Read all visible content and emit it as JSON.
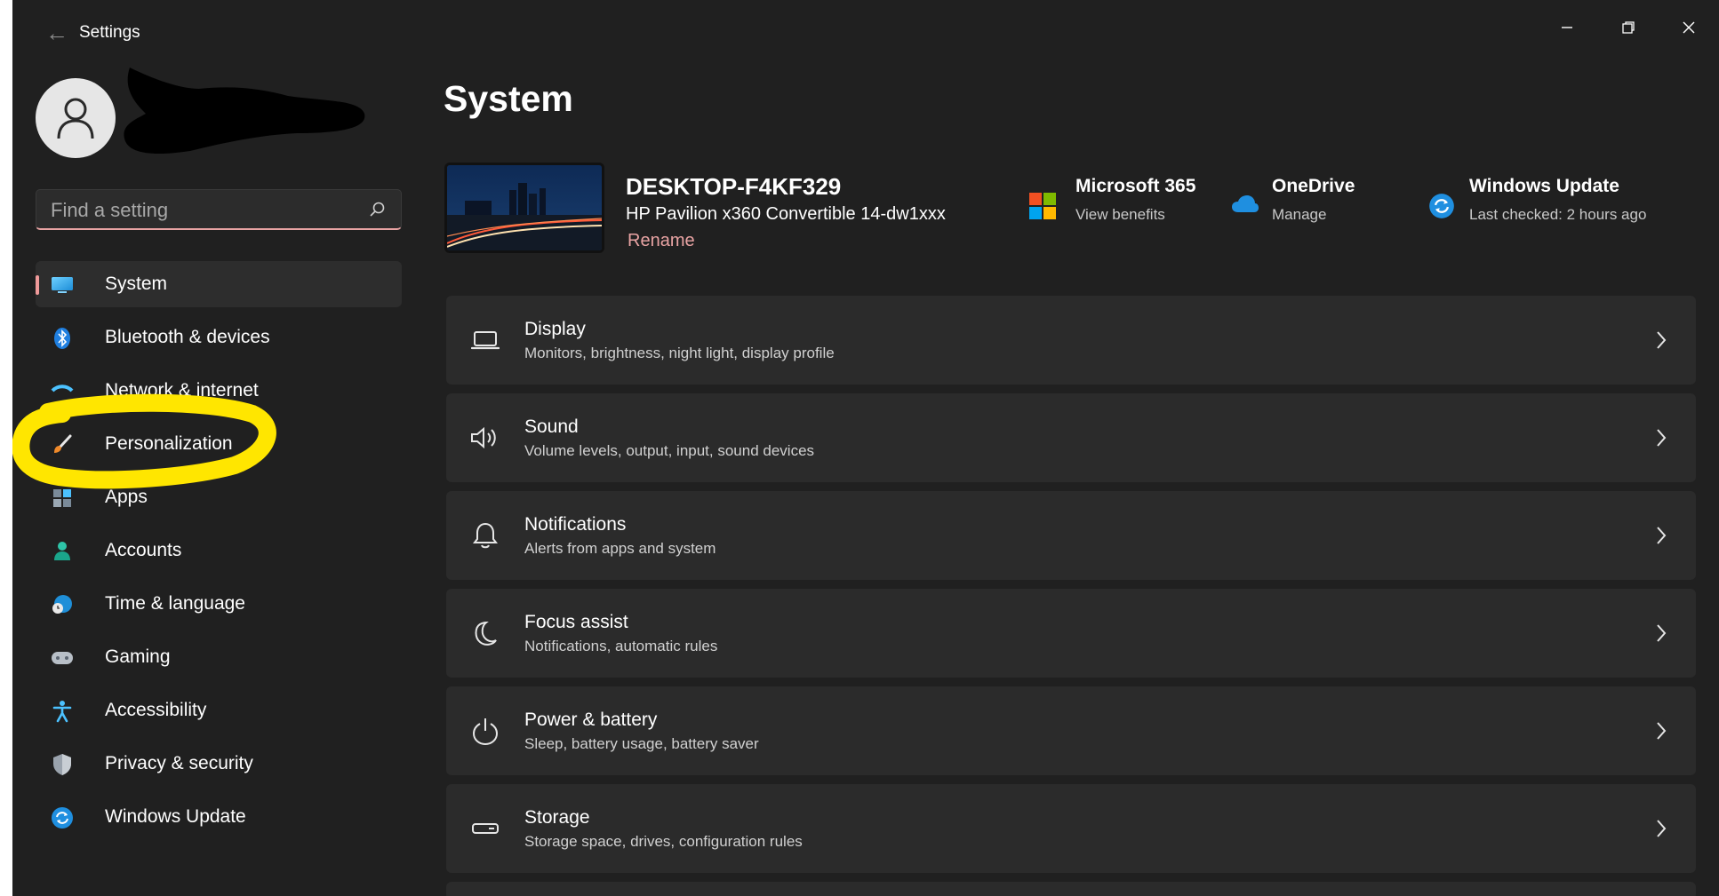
{
  "window": {
    "title": "Settings"
  },
  "search": {
    "placeholder": "Find a setting"
  },
  "sidebar": {
    "items": [
      {
        "label": "System",
        "icon": "monitor-icon"
      },
      {
        "label": "Bluetooth & devices",
        "icon": "bluetooth-icon"
      },
      {
        "label": "Network & internet",
        "icon": "wifi-icon"
      },
      {
        "label": "Personalization",
        "icon": "brush-icon"
      },
      {
        "label": "Apps",
        "icon": "apps-icon"
      },
      {
        "label": "Accounts",
        "icon": "person-icon"
      },
      {
        "label": "Time & language",
        "icon": "globe-clock-icon"
      },
      {
        "label": "Gaming",
        "icon": "gamepad-icon"
      },
      {
        "label": "Accessibility",
        "icon": "accessibility-icon"
      },
      {
        "label": "Privacy & security",
        "icon": "shield-icon"
      },
      {
        "label": "Windows Update",
        "icon": "sync-icon"
      }
    ],
    "active_index": 0
  },
  "main": {
    "title": "System",
    "device": {
      "name": "DESKTOP-F4KF329",
      "model": "HP Pavilion x360 Convertible 14-dw1xxx",
      "rename_label": "Rename"
    },
    "quick_links": [
      {
        "title": "Microsoft 365",
        "subtitle": "View benefits",
        "icon": "microsoft-logo-icon"
      },
      {
        "title": "OneDrive",
        "subtitle": "Manage",
        "icon": "cloud-icon"
      },
      {
        "title": "Windows Update",
        "subtitle": "Last checked: 2 hours ago",
        "icon": "sync-icon"
      }
    ],
    "cards": [
      {
        "title": "Display",
        "subtitle": "Monitors, brightness, night light, display profile",
        "icon": "laptop-icon"
      },
      {
        "title": "Sound",
        "subtitle": "Volume levels, output, input, sound devices",
        "icon": "speaker-icon"
      },
      {
        "title": "Notifications",
        "subtitle": "Alerts from apps and system",
        "icon": "bell-icon"
      },
      {
        "title": "Focus assist",
        "subtitle": "Notifications, automatic rules",
        "icon": "moon-icon"
      },
      {
        "title": "Power & battery",
        "subtitle": "Sleep, battery usage, battery saver",
        "icon": "power-icon"
      },
      {
        "title": "Storage",
        "subtitle": "Storage space, drives, configuration rules",
        "icon": "storage-icon"
      }
    ]
  },
  "colors": {
    "background": "#202020",
    "card": "#2b2b2b",
    "accent": "#e8a3a3",
    "highlight_annotation": "#ffe600"
  }
}
